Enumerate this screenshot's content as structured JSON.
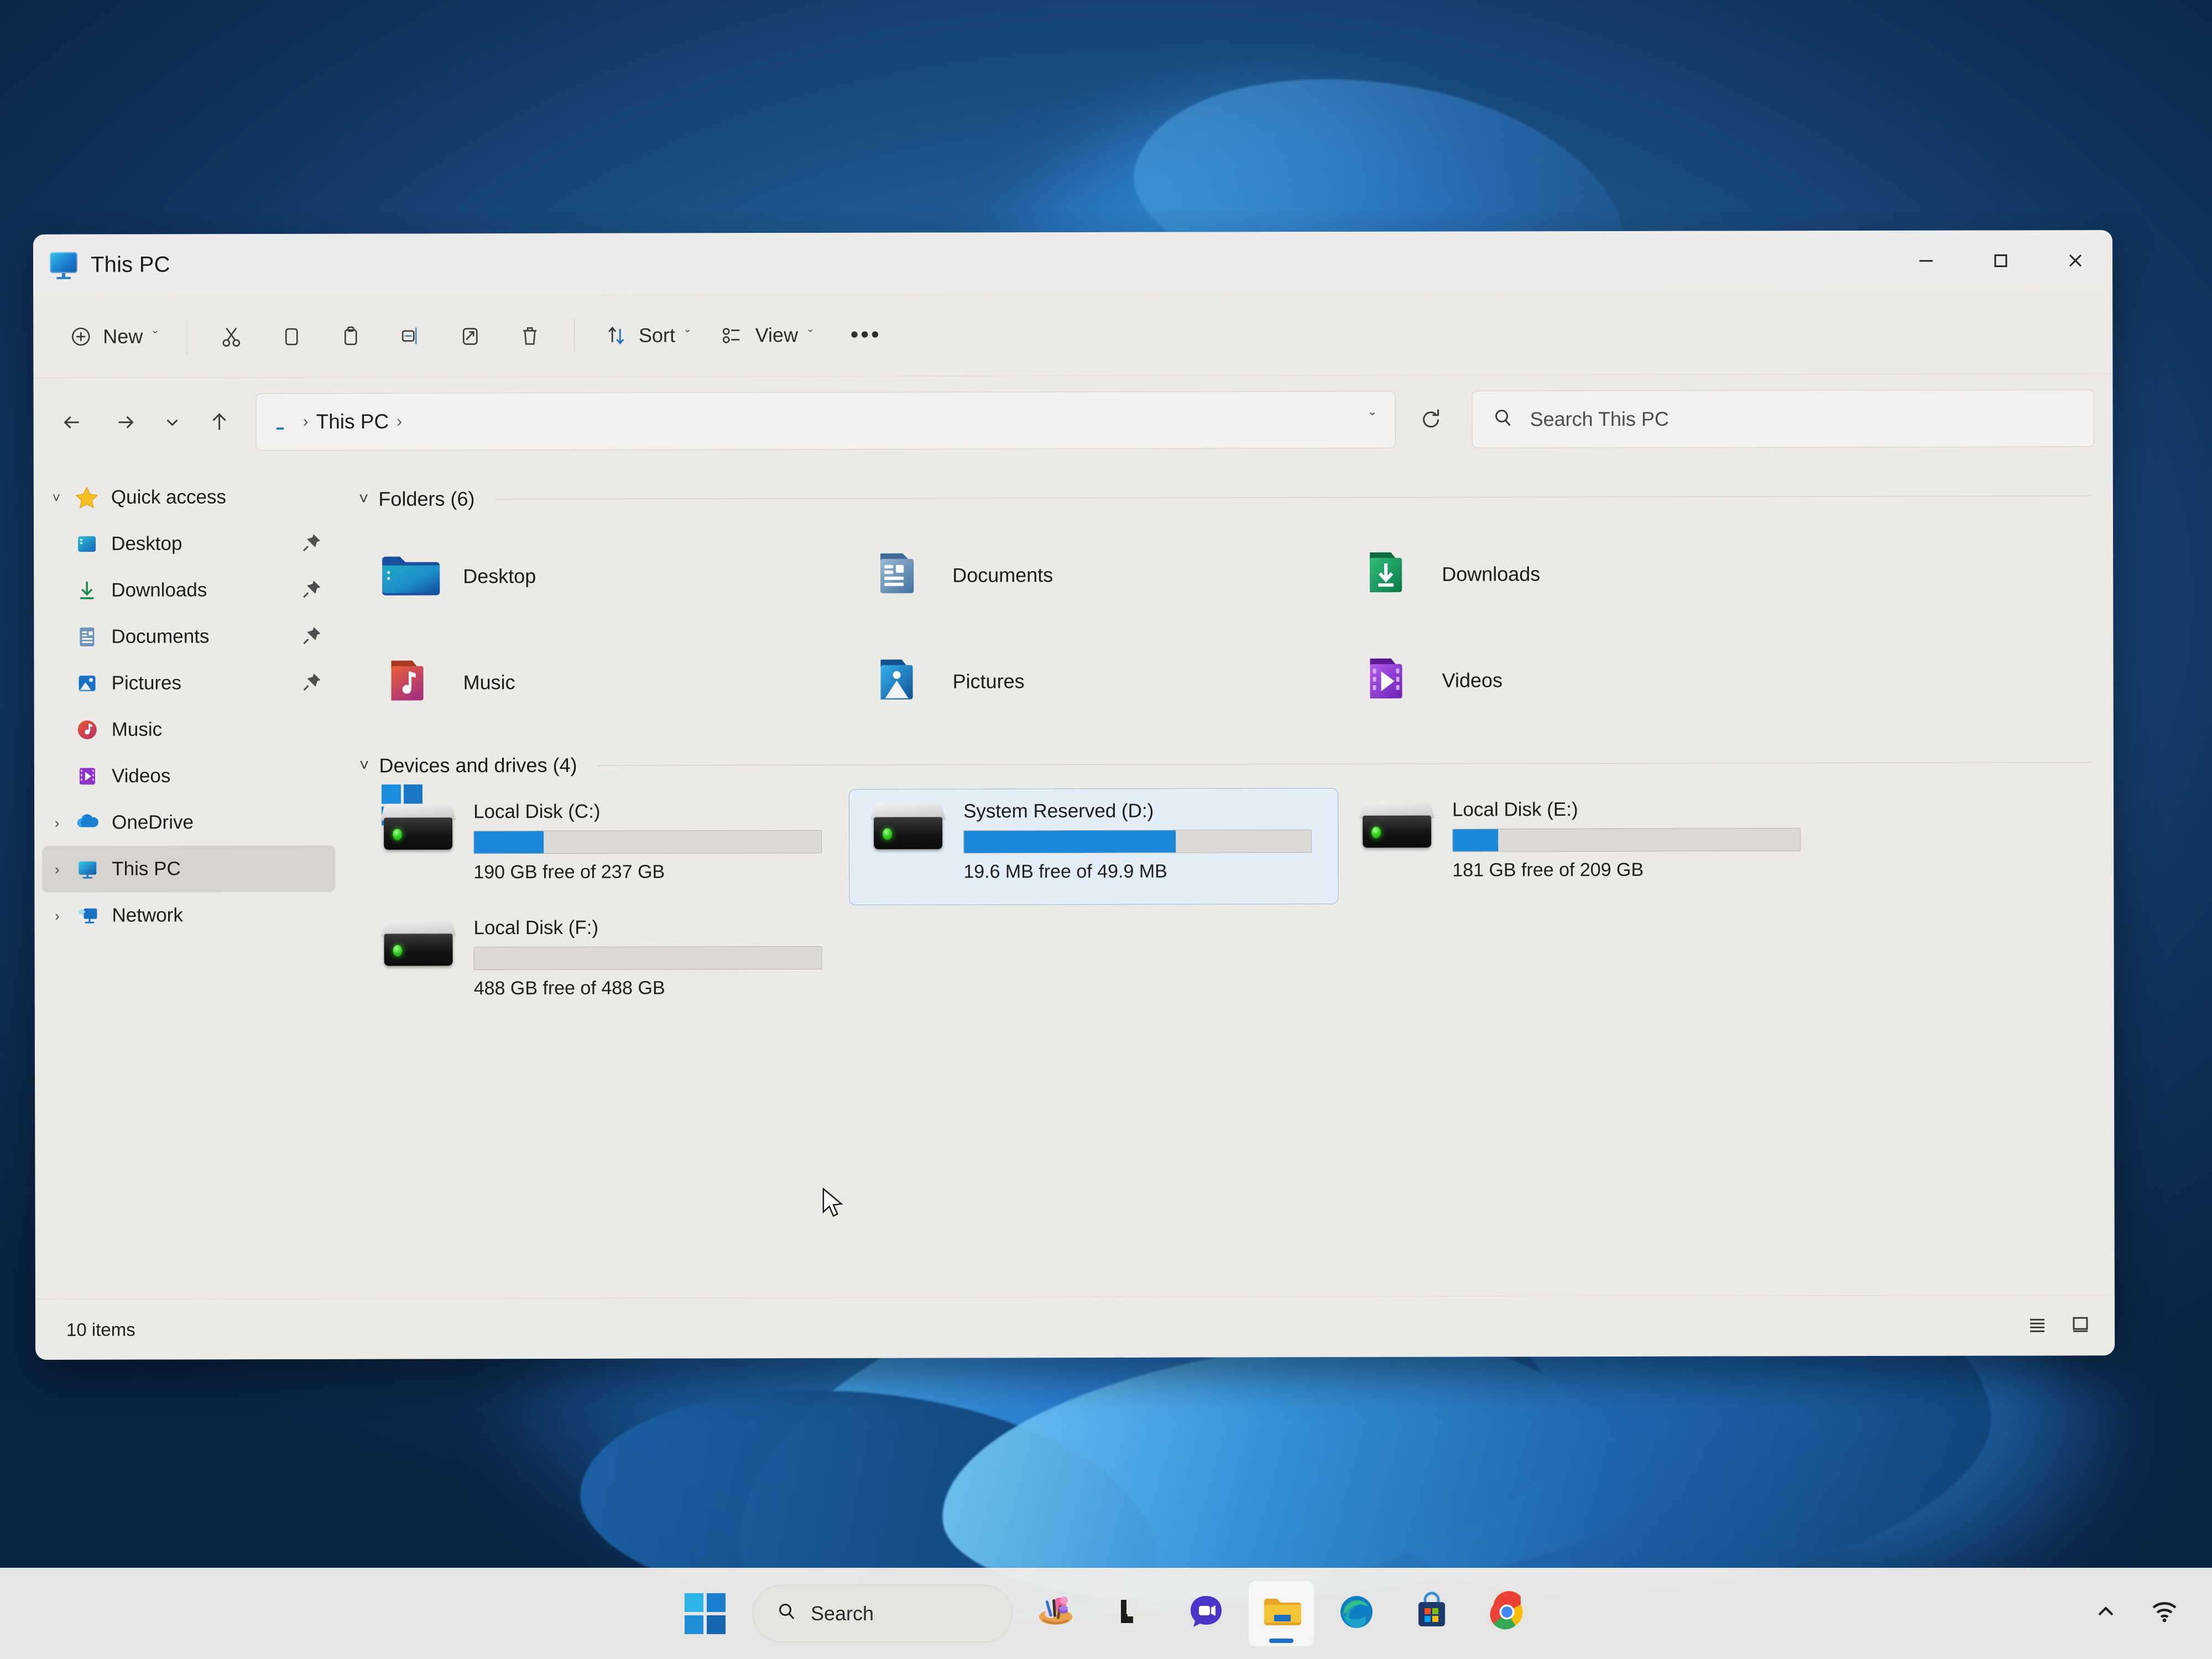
{
  "window": {
    "title": "This PC",
    "title_icon": "this-pc-monitor-icon",
    "controls": {
      "minimize": "—",
      "maximize": "□",
      "close": "✕"
    }
  },
  "commandbar": {
    "new_label": "New",
    "new_icon": "plus-circle-icon",
    "cut_icon": "scissors-icon",
    "copy_icon": "copy-icon",
    "paste_icon": "paste-icon",
    "rename_icon": "rename-icon",
    "share_icon": "share-icon",
    "delete_icon": "trash-icon",
    "sort_label": "Sort",
    "sort_icon": "sort-arrows-icon",
    "view_label": "View",
    "view_icon": "view-list-icon",
    "more_label": "•••",
    "chevron": "ˇ"
  },
  "addressbar": {
    "back_icon": "back-arrow-icon",
    "forward_icon": "forward-arrow-icon",
    "recent_icon": "chevron-down-icon",
    "up_icon": "up-arrow-icon",
    "breadcrumb_icon": "this-pc-monitor-icon",
    "breadcrumb": "This PC",
    "separator": "›",
    "dropdown_chevron": "ˇ",
    "refresh_icon": "refresh-icon"
  },
  "search": {
    "icon": "search-icon",
    "placeholder": "Search This PC"
  },
  "sidebar": {
    "items": [
      {
        "label": "Quick access",
        "icon": "star-icon",
        "expander": "˅",
        "indent": false,
        "pinned": false,
        "selected": false
      },
      {
        "label": "Desktop",
        "icon": "desktop-icon",
        "expander": "",
        "indent": true,
        "pinned": true,
        "selected": false
      },
      {
        "label": "Downloads",
        "icon": "download-icon",
        "expander": "",
        "indent": true,
        "pinned": true,
        "selected": false
      },
      {
        "label": "Documents",
        "icon": "document-icon",
        "expander": "",
        "indent": true,
        "pinned": true,
        "selected": false
      },
      {
        "label": "Pictures",
        "icon": "picture-icon",
        "expander": "",
        "indent": true,
        "pinned": true,
        "selected": false
      },
      {
        "label": "Music",
        "icon": "music-icon",
        "expander": "",
        "indent": true,
        "pinned": false,
        "selected": false
      },
      {
        "label": "Videos",
        "icon": "video-icon",
        "expander": "",
        "indent": true,
        "pinned": false,
        "selected": false
      },
      {
        "label": "OneDrive",
        "icon": "cloud-icon",
        "expander": "›",
        "indent": false,
        "pinned": false,
        "selected": false
      },
      {
        "label": "This PC",
        "icon": "this-pc-icon",
        "expander": "›",
        "indent": false,
        "pinned": false,
        "selected": true
      },
      {
        "label": "Network",
        "icon": "network-icon",
        "expander": "›",
        "indent": false,
        "pinned": false,
        "selected": false
      }
    ],
    "pin_icon": "pin-icon"
  },
  "content": {
    "folders_group": {
      "caret": "˅",
      "title": "Folders (6)",
      "items": [
        {
          "name": "Desktop",
          "icon": "folder-desktop-icon"
        },
        {
          "name": "Documents",
          "icon": "folder-documents-icon"
        },
        {
          "name": "Downloads",
          "icon": "folder-downloads-icon"
        },
        {
          "name": "Music",
          "icon": "folder-music-icon"
        },
        {
          "name": "Pictures",
          "icon": "folder-pictures-icon"
        },
        {
          "name": "Videos",
          "icon": "folder-videos-icon"
        }
      ]
    },
    "drives_group": {
      "caret": "˅",
      "title": "Devices and drives (4)",
      "items": [
        {
          "name": "Local Disk (C:)",
          "free_text": "190 GB free of 237 GB",
          "used_percent": 20,
          "selected": false,
          "has_windows_logo": true,
          "icon": "hard-drive-icon"
        },
        {
          "name": "System Reserved (D:)",
          "free_text": "19.6 MB free of 49.9 MB",
          "used_percent": 61,
          "selected": true,
          "has_windows_logo": false,
          "icon": "hard-drive-icon"
        },
        {
          "name": "Local Disk (E:)",
          "free_text": "181 GB free of 209 GB",
          "used_percent": 13,
          "selected": false,
          "has_windows_logo": false,
          "icon": "hard-drive-icon"
        },
        {
          "name": "Local Disk (F:)",
          "free_text": "488 GB free of 488 GB",
          "used_percent": 0,
          "selected": false,
          "has_windows_logo": false,
          "icon": "hard-drive-icon"
        }
      ]
    }
  },
  "statusbar": {
    "item_count": "10 items",
    "details_view_icon": "details-view-icon",
    "large_icons_view_icon": "large-icons-view-icon"
  },
  "taskbar": {
    "start_icon": "windows-start-icon",
    "search_label": "Search",
    "search_icon": "search-icon",
    "items": [
      {
        "name": "paint-icon",
        "active": false
      },
      {
        "name": "copilot-icon",
        "active": false
      },
      {
        "name": "chat-teams-icon",
        "active": false
      },
      {
        "name": "file-explorer-icon",
        "active": true
      },
      {
        "name": "edge-icon",
        "active": false
      },
      {
        "name": "microsoft-store-icon",
        "active": false
      },
      {
        "name": "chrome-icon",
        "active": false
      }
    ],
    "tray": {
      "overflow_icon": "chevron-up-icon",
      "wifi_icon": "wifi-icon"
    }
  },
  "colors": {
    "accent": "#1a87d8",
    "window_bg": "#eceae7",
    "selection_bg": "#e3eef8",
    "selection_border": "#8bb8da",
    "sidebar_selected": "#d6d3cf"
  }
}
